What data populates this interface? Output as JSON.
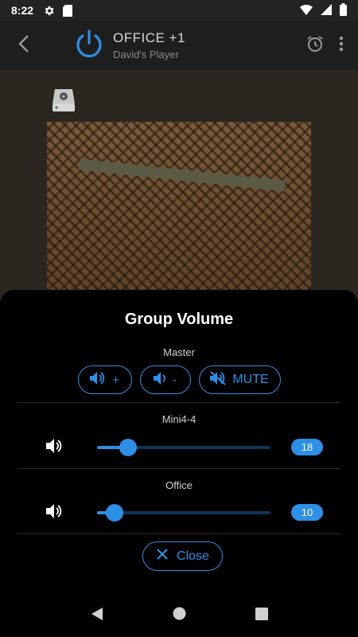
{
  "status_bar": {
    "time": "8:22"
  },
  "app_bar": {
    "title": "OFFICE +1",
    "subtitle": "David's Player"
  },
  "sheet": {
    "title": "Group Volume",
    "master": {
      "label": "Master",
      "volume_up_label": "+",
      "volume_down_label": "-",
      "mute_label": "MUTE"
    },
    "zones": [
      {
        "name": "Mini4-4",
        "volume": 18,
        "level": 0.18
      },
      {
        "name": "Office",
        "volume": 10,
        "level": 0.1
      }
    ],
    "close_label": "Close"
  },
  "colors": {
    "accent": "#2e8fe6",
    "sheet_bg": "#000000",
    "app_bar_bg": "#1e1e1e"
  },
  "icons": [
    "settings-icon",
    "sd-card-icon",
    "wifi-icon",
    "signal-icon",
    "battery-icon",
    "back-icon",
    "power-icon",
    "alarm-icon",
    "more-vert-icon",
    "media-server-icon",
    "volume-icon",
    "volume-off-icon",
    "close-icon"
  ]
}
